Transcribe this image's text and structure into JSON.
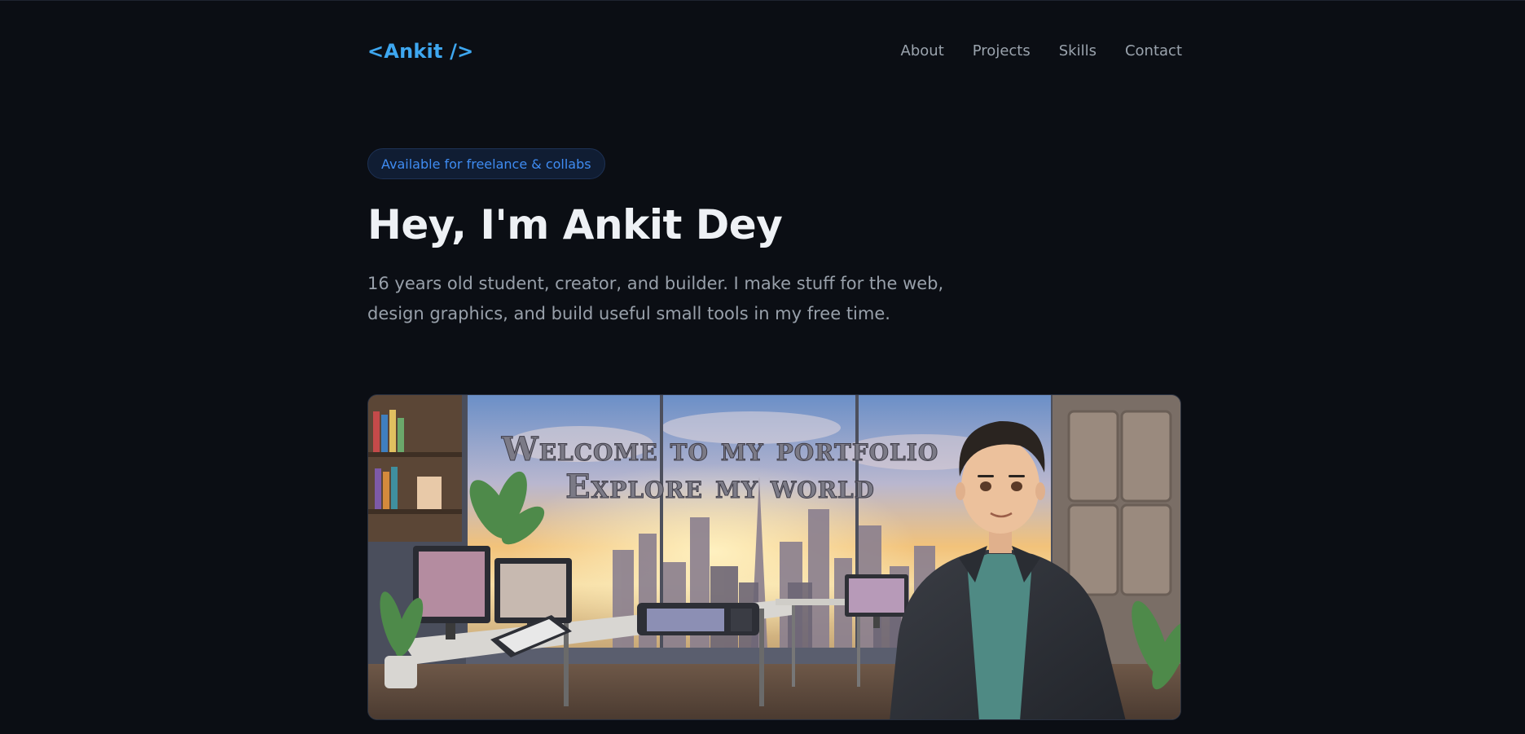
{
  "header": {
    "logo": "<Ankit />",
    "nav": [
      "About",
      "Projects",
      "Skills",
      "Contact"
    ]
  },
  "hero": {
    "badge": "Available for freelance & collabs",
    "title": "Hey, I'm Ankit Dey",
    "intro": "16 years old student, creator, and builder. I make stuff for the web, design graphics, and build useful small tools in my free time.",
    "banner_line1": "Welcome to my portfolio",
    "banner_line2": "Explore my world"
  },
  "colors": {
    "background": "#0b0e14",
    "accent": "#3ea7f0",
    "badge_text": "#3f8cf2"
  }
}
